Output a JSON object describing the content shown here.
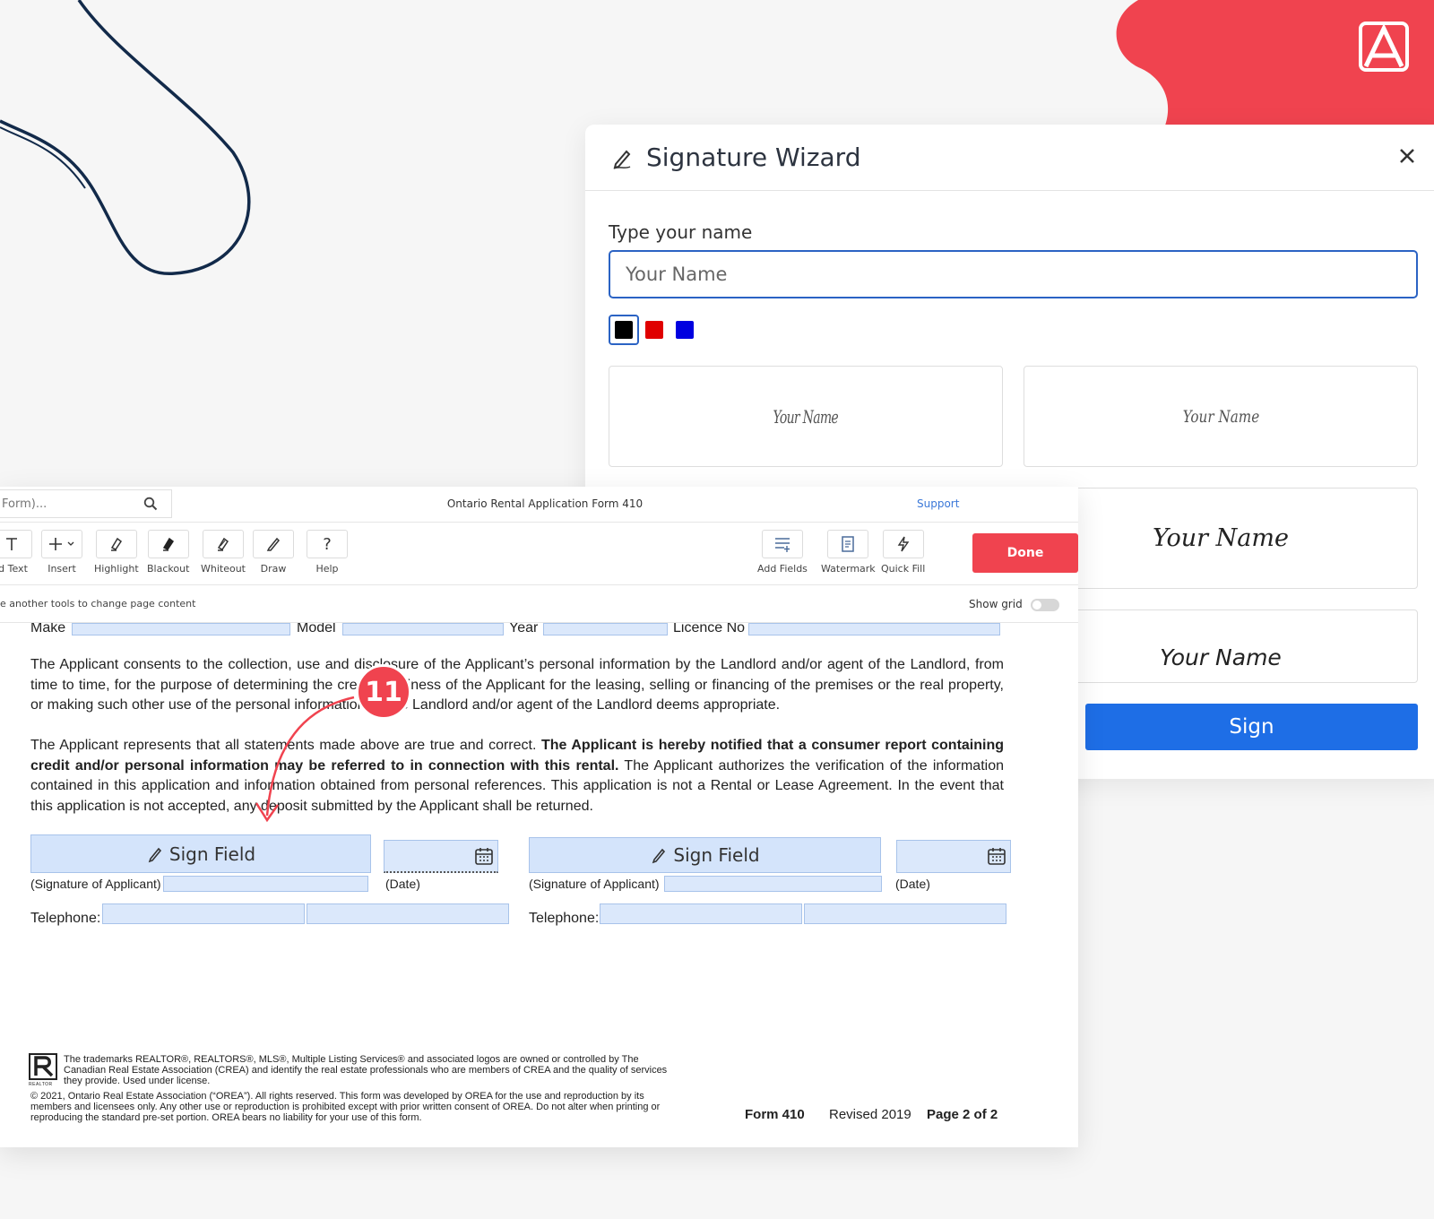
{
  "wizard": {
    "title": "Signature Wizard",
    "label": "Type your name",
    "placeholder": "Your Name",
    "colors": [
      {
        "name": "black",
        "hex": "#000000",
        "selected": true
      },
      {
        "name": "red",
        "hex": "#e00000",
        "selected": false
      },
      {
        "name": "blue",
        "hex": "#0000e0",
        "selected": false
      }
    ],
    "samples": [
      "Your Name",
      "Your Name",
      "Your Name",
      "Your Name"
    ],
    "sign_label": "Sign"
  },
  "editor": {
    "search_placeholder": "Form)...",
    "doc_title": "Ontario Rental Application Form 410",
    "support": "Support",
    "tools_left": [
      {
        "icon": "text-icon",
        "label": "ld Text"
      },
      {
        "icon": "plus-icon",
        "label": "Insert"
      },
      {
        "icon": "highlight-icon",
        "label": "Highlight"
      },
      {
        "icon": "blackout-icon",
        "label": "Blackout"
      },
      {
        "icon": "whiteout-icon",
        "label": "Whiteout"
      },
      {
        "icon": "draw-icon",
        "label": "Draw"
      },
      {
        "icon": "help-icon",
        "label": "Help"
      }
    ],
    "tools_right": [
      {
        "icon": "add-fields-icon",
        "label": "Add Fields"
      },
      {
        "icon": "watermark-icon",
        "label": "Watermark"
      },
      {
        "icon": "quick-fill-icon",
        "label": "Quick Fill"
      }
    ],
    "done": "Done",
    "hint": "e another tools to change page content",
    "show_grid": "Show grid"
  },
  "document": {
    "vehicle_labels": {
      "make": "Make",
      "model": "Model",
      "year": "Year",
      "licence": "Licence No"
    },
    "para1": "The Applicant consents to the collection, use and disclosure of the Applicant’s personal information by the Landlord and/or agent of the Landlord, from time to time, for the purpose of determining the creditworthiness of the Applicant for the leasing, selling or financing of the premises or the real property, or making such other use of the personal information as the Landlord and/or agent of the Landlord deems appropriate.",
    "para2_start": "The Applicant represents that all statements made above are true and correct. ",
    "para2_bold": "The Applicant is hereby notified that a consumer report containing credit and/or personal information may be referred to in connection with this rental.",
    "para2_end": " The Applicant authorizes the verification of the information contained in this application and information obtained from personal references. This application is not a Rental or Lease Agreement. In the event that this application is not accepted, any deposit submitted by the Applicant shall be returned.",
    "sign_field": "Sign Field",
    "sig_label": "(Signature of Applicant)",
    "date_label": "(Date)",
    "telephone": "Telephone:",
    "footer1": "The trademarks REALTOR®, REALTORS®, MLS®, Multiple Listing Services® and associated logos are owned or controlled by The Canadian Real Estate Association (CREA) and identify the real estate professionals who are members of CREA and the quality of services they provide. Used under license.",
    "footer2": "© 2021, Ontario Real Estate Association (“OREA”). All rights reserved. This form was developed by OREA for the use and reproduction by its members and licensees only. Any other use or reproduction is prohibited except with prior written consent of OREA. Do not alter when printing or reproducing the standard pre-set portion. OREA bears no liability for your use of this form.",
    "logo_caption": "REALTOR",
    "form_no": "Form 410",
    "revised": "Revised 2019",
    "page": "Page 2 of 2"
  },
  "step_badge": "11",
  "colors": {
    "accent_red": "#f0434f",
    "accent_blue": "#1e6ee6",
    "field_blue": "#dbe8fb"
  }
}
